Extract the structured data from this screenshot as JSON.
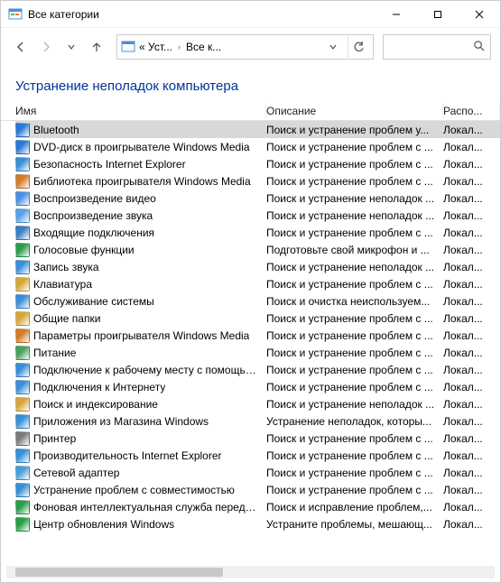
{
  "window": {
    "title": "Все категории"
  },
  "breadcrumb": {
    "part1": "« Уст...",
    "part2": "Все к..."
  },
  "heading": "Устранение неполадок компьютера",
  "columns": {
    "name": "Имя",
    "desc": "Описание",
    "loc": "Распо..."
  },
  "items": [
    {
      "name": "Bluetooth",
      "desc": "Поиск и устранение проблем у...",
      "loc": "Локал...",
      "selected": true,
      "color": "#2a7ad4"
    },
    {
      "name": "DVD-диск в проигрывателе Windows Media",
      "desc": "Поиск и устранение проблем с ...",
      "loc": "Локал...",
      "color": "#2a7ad4"
    },
    {
      "name": "Безопасность Internet Explorer",
      "desc": "Поиск и устранение проблем с ...",
      "loc": "Локал...",
      "color": "#3a8fd6"
    },
    {
      "name": "Библиотека проигрывателя Windows Media",
      "desc": "Поиск и устранение проблем с ...",
      "loc": "Локал...",
      "color": "#d17b2a"
    },
    {
      "name": "Воспроизведение видео",
      "desc": "Поиск и устранение неполадок ...",
      "loc": "Локал...",
      "color": "#4a90e2"
    },
    {
      "name": "Воспроизведение звука",
      "desc": "Поиск и устранение неполадок ...",
      "loc": "Локал...",
      "color": "#5aa0e8"
    },
    {
      "name": "Входящие подключения",
      "desc": "Поиск и устранение проблем с ...",
      "loc": "Локал...",
      "color": "#3a7fc4"
    },
    {
      "name": "Голосовые функции",
      "desc": "Подготовьте свой микрофон и ...",
      "loc": "Локал...",
      "color": "#2a9d4a"
    },
    {
      "name": "Запись звука",
      "desc": "Поиск и устранение неполадок ...",
      "loc": "Локал...",
      "color": "#3a8fd6"
    },
    {
      "name": "Клавиатура",
      "desc": "Поиск и устранение проблем с ...",
      "loc": "Локал...",
      "color": "#d6a63a"
    },
    {
      "name": "Обслуживание системы",
      "desc": "Поиск и очистка неиспользуем...",
      "loc": "Локал...",
      "color": "#3a8fd6"
    },
    {
      "name": "Общие папки",
      "desc": "Поиск и устранение проблем с ...",
      "loc": "Локал...",
      "color": "#d6a63a"
    },
    {
      "name": "Параметры проигрывателя Windows Media",
      "desc": "Поиск и устранение проблем с ...",
      "loc": "Локал...",
      "color": "#d17b2a"
    },
    {
      "name": "Питание",
      "desc": "Поиск и устранение проблем с ...",
      "loc": "Локал...",
      "color": "#4aa05a"
    },
    {
      "name": "Подключение к рабочему месту с помощью ...",
      "desc": "Поиск и устранение проблем с ...",
      "loc": "Локал...",
      "color": "#3a8fd6"
    },
    {
      "name": "Подключения к Интернету",
      "desc": "Поиск и устранение проблем с ...",
      "loc": "Локал...",
      "color": "#3a8fd6"
    },
    {
      "name": "Поиск и индексирование",
      "desc": "Поиск и устранение неполадок ...",
      "loc": "Локал...",
      "color": "#d6a63a"
    },
    {
      "name": "Приложения из Магазина Windows",
      "desc": "Устранение неполадок, которы...",
      "loc": "Локал...",
      "color": "#3a8fd6"
    },
    {
      "name": "Принтер",
      "desc": "Поиск и устранение проблем с ...",
      "loc": "Локал...",
      "color": "#7a7a7a"
    },
    {
      "name": "Производительность Internet Explorer",
      "desc": "Поиск и устранение проблем с ...",
      "loc": "Локал...",
      "color": "#3a8fd6"
    },
    {
      "name": "Сетевой адаптер",
      "desc": "Поиск и устранение проблем с ...",
      "loc": "Локал...",
      "color": "#4aa0d6"
    },
    {
      "name": "Устранение проблем с совместимостью",
      "desc": "Поиск и устранение проблем с ...",
      "loc": "Локал...",
      "color": "#3a8fd6"
    },
    {
      "name": "Фоновая интеллектуальная служба передачи (...",
      "desc": "Поиск и исправление проблем,...",
      "loc": "Локал...",
      "color": "#2a9d4a"
    },
    {
      "name": "Центр обновления Windows",
      "desc": "Устраните проблемы, мешающ...",
      "loc": "Локал...",
      "color": "#2a9d4a"
    }
  ]
}
